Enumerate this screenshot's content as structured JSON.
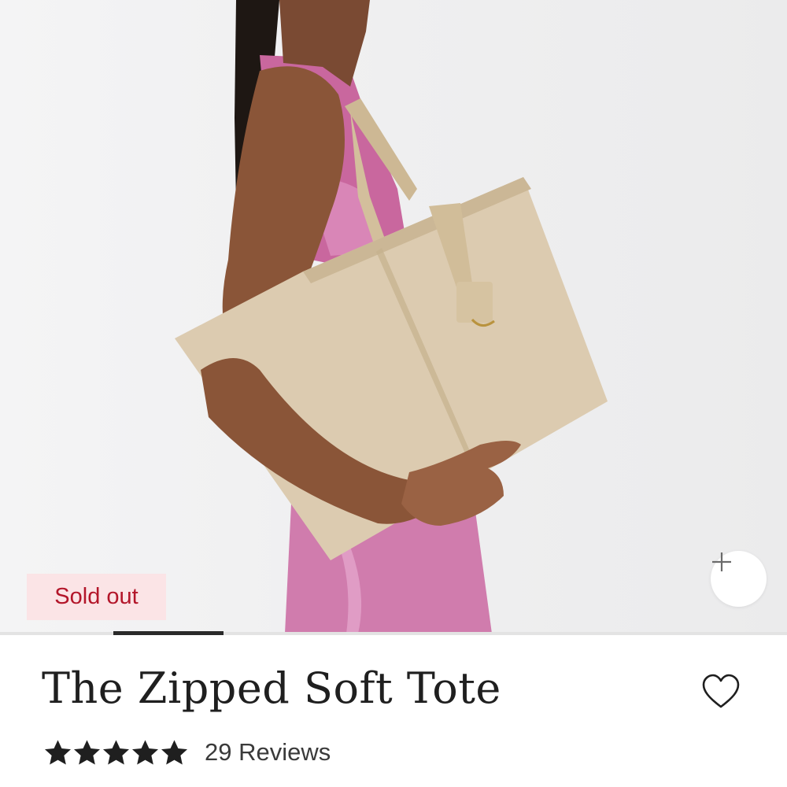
{
  "product": {
    "badge": "Sold out",
    "title": "The Zipped Soft Tote",
    "rating": 5,
    "rating_max": 5,
    "reviews_label": "29 Reviews"
  },
  "gallery": {
    "current_image": 2,
    "image_progress": 0.14,
    "expand_icon": "plus-icon"
  },
  "icons": {
    "wishlist": "heart-icon",
    "star": "star-icon"
  },
  "colors": {
    "badge_bg": "#fbe4e6",
    "badge_text": "#b3162a",
    "bag": "#dccbb0",
    "dress": "#d47fb0",
    "text": "#1f1f1f"
  }
}
